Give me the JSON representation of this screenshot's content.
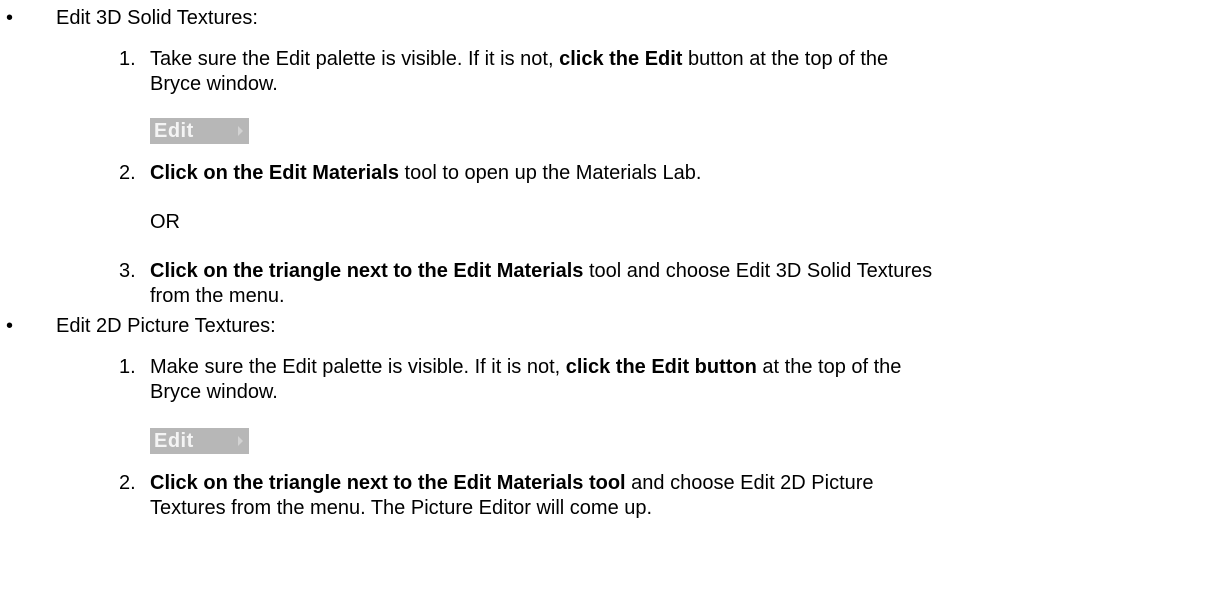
{
  "sections": [
    {
      "heading": "Edit 3D Solid Textures:",
      "step1": {
        "number": "1.",
        "pre": "Take sure the Edit palette is visible. If it is not, ",
        "bold": "click the Edit",
        "post": " button at the top of the",
        "line2": "Bryce window."
      },
      "button_label": "Edit",
      "step2": {
        "number": "2.",
        "bold": "Click on the Edit Materials",
        "post": " tool to open up the Materials Lab."
      },
      "or_text": "OR",
      "step3": {
        "number": "3.",
        "bold": "Click on the triangle next to the Edit Materials",
        "post": " tool and choose Edit 3D Solid Textures",
        "line2": "from the menu."
      }
    },
    {
      "heading": "Edit 2D Picture Textures:",
      "step1": {
        "number": "1.",
        "pre": "Make sure the Edit palette is visible. If it is not, ",
        "bold": "click the Edit button",
        "post": " at the top of the",
        "line2": "Bryce window."
      },
      "button_label": "Edit",
      "step2": {
        "number": "2.",
        "bold": "Click on the triangle next to the Edit Materials tool",
        "post": " and choose Edit 2D Picture",
        "line2": "Textures from the menu. The Picture Editor will come up."
      }
    }
  ],
  "bullet_glyph": "•"
}
